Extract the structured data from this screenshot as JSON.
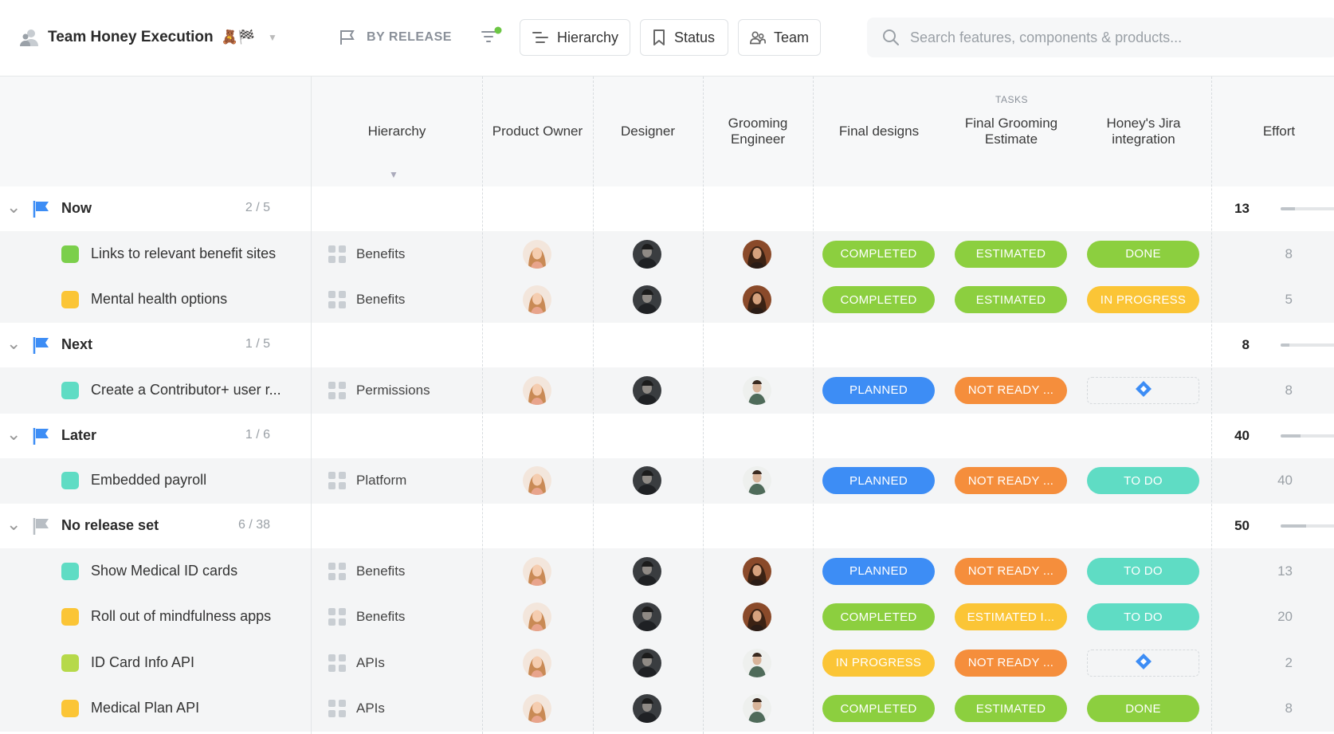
{
  "workspace": {
    "name": "Team Honey Execution",
    "emoji": "🧸🏁"
  },
  "toolbar": {
    "by_release": "BY RELEASE",
    "hierarchy": "Hierarchy",
    "status": "Status",
    "team": "Team"
  },
  "search": {
    "placeholder": "Search features, components & products..."
  },
  "columns": {
    "hierarchy": "Hierarchy",
    "product_owner": "Product Owner",
    "designer": "Designer",
    "grooming_engineer": "Grooming Engineer",
    "tasks_group": "TASKS",
    "final_designs": "Final designs",
    "final_grooming": "Final Grooming Estimate",
    "jira": "Honey's Jira integration",
    "effort": "Effort"
  },
  "colors": {
    "green": "#8ccf3f",
    "blue": "#3d8df5",
    "orange": "#f58e3c",
    "yellow": "#fbc536",
    "teal": "#5fdcc4",
    "flag_blue": "#3d8df5",
    "flag_gray": "#b8bec4",
    "sq_green": "#7bcf4b",
    "sq_yellow": "#fbc536",
    "sq_teal": "#5fdcc4",
    "sq_lime": "#b6d94a"
  },
  "groups": [
    {
      "name": "Now",
      "count": "2 / 5",
      "effort": "13",
      "effort_fraction": 0.26,
      "flag": "blue",
      "items": [
        {
          "name": "Links to relevant benefit sites",
          "color": "sq_green",
          "hierarchy": "Benefits",
          "engineer": "a",
          "final_designs": {
            "t": "COMPLETED",
            "c": "green"
          },
          "grooming": {
            "t": "ESTIMATED",
            "c": "green"
          },
          "jira": {
            "t": "DONE",
            "c": "green"
          },
          "effort": "8"
        },
        {
          "name": "Mental health options",
          "color": "sq_yellow",
          "hierarchy": "Benefits",
          "engineer": "a",
          "final_designs": {
            "t": "COMPLETED",
            "c": "green"
          },
          "grooming": {
            "t": "ESTIMATED",
            "c": "green"
          },
          "jira": {
            "t": "IN PROGRESS",
            "c": "yellow"
          },
          "effort": "5"
        }
      ]
    },
    {
      "name": "Next",
      "count": "1 / 5",
      "effort": "8",
      "effort_fraction": 0.16,
      "flag": "blue",
      "items": [
        {
          "name": "Create a Contributor+ user r...",
          "color": "sq_teal",
          "hierarchy": "Permissions",
          "engineer": "b",
          "final_designs": {
            "t": "PLANNED",
            "c": "blue"
          },
          "grooming": {
            "t": "NOT READY ...",
            "c": "orange"
          },
          "jira": {
            "t": "",
            "c": "empty"
          },
          "effort": "8"
        }
      ]
    },
    {
      "name": "Later",
      "count": "1 / 6",
      "effort": "40",
      "effort_fraction": 0.36,
      "flag": "blue",
      "items": [
        {
          "name": "Embedded payroll",
          "color": "sq_teal",
          "hierarchy": "Platform",
          "engineer": "b",
          "final_designs": {
            "t": "PLANNED",
            "c": "blue"
          },
          "grooming": {
            "t": "NOT READY ...",
            "c": "orange"
          },
          "jira": {
            "t": "TO DO",
            "c": "teal"
          },
          "effort": "40"
        }
      ]
    },
    {
      "name": "No release set",
      "count": "6 / 38",
      "effort": "50",
      "effort_fraction": 0.46,
      "flag": "gray",
      "items": [
        {
          "name": "Show Medical ID cards",
          "color": "sq_teal",
          "hierarchy": "Benefits",
          "engineer": "a",
          "final_designs": {
            "t": "PLANNED",
            "c": "blue"
          },
          "grooming": {
            "t": "NOT READY ...",
            "c": "orange"
          },
          "jira": {
            "t": "TO DO",
            "c": "teal"
          },
          "effort": "13"
        },
        {
          "name": "Roll out of mindfulness apps",
          "color": "sq_yellow",
          "hierarchy": "Benefits",
          "engineer": "a",
          "final_designs": {
            "t": "COMPLETED",
            "c": "green"
          },
          "grooming": {
            "t": "ESTIMATED I...",
            "c": "yellow"
          },
          "jira": {
            "t": "TO DO",
            "c": "teal"
          },
          "effort": "20"
        },
        {
          "name": "ID Card Info API",
          "color": "sq_lime",
          "hierarchy": "APIs",
          "engineer": "b",
          "final_designs": {
            "t": "IN PROGRESS",
            "c": "yellow"
          },
          "grooming": {
            "t": "NOT READY ...",
            "c": "orange"
          },
          "jira": {
            "t": "",
            "c": "empty"
          },
          "effort": "2"
        },
        {
          "name": "Medical Plan API",
          "color": "sq_yellow",
          "hierarchy": "APIs",
          "engineer": "b",
          "final_designs": {
            "t": "COMPLETED",
            "c": "green"
          },
          "grooming": {
            "t": "ESTIMATED",
            "c": "green"
          },
          "jira": {
            "t": "DONE",
            "c": "green"
          },
          "effort": "8"
        }
      ]
    }
  ]
}
